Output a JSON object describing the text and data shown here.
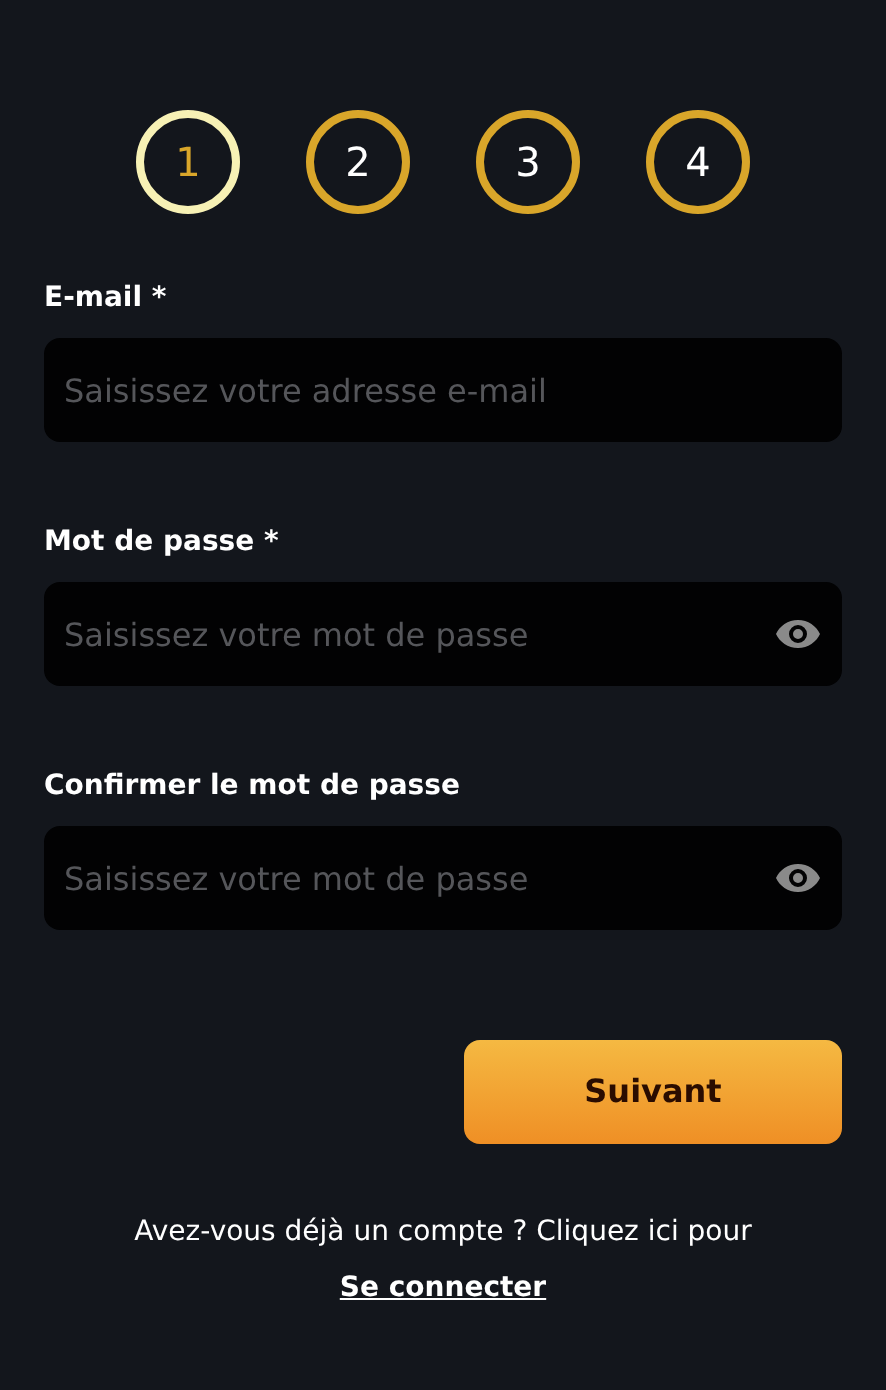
{
  "steps": [
    {
      "label": "1",
      "selected": true
    },
    {
      "label": "2",
      "selected": false
    },
    {
      "label": "3",
      "selected": false
    },
    {
      "label": "4",
      "selected": false
    }
  ],
  "fields": [
    {
      "label": "E-mail *",
      "placeholder": "Saisissez votre adresse e-mail",
      "kind": "text"
    },
    {
      "label": "Mot de passe *",
      "placeholder": "Saisissez votre mot de passe",
      "kind": "password"
    },
    {
      "label": "Confirmer le mot de passe",
      "placeholder": "Saisissez votre mot de passe",
      "kind": "password"
    }
  ],
  "next_button": "Suivant",
  "footer": {
    "text": "Avez-vous déjà un compte ? Cliquez ici pour",
    "link": "Se connecter"
  }
}
